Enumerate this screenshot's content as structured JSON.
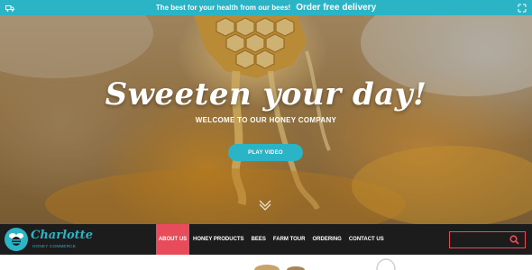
{
  "colors": {
    "accent": "#2bb3c6",
    "nav_active": "#e84b5a",
    "nav_bg": "#1c1c1c"
  },
  "promo": {
    "text": "The best for your health from our bees!",
    "cta": "Order free delivery",
    "left_icon": "truck-icon",
    "right_icon": "expand-icon"
  },
  "hero": {
    "title": "Sweeten your day!",
    "subtitle": "WELCOME TO OUR HONEY COMPANY",
    "button_label": "PLAY VIDEO",
    "scroll_icon": "chevron-down-icon"
  },
  "logo": {
    "name": "Charlotte",
    "tagline": "HONEY COMMERCE",
    "icon": "bee-icon"
  },
  "nav": {
    "items": [
      {
        "label": "ABOUT US",
        "active": true
      },
      {
        "label": "HONEY PRODUCTS"
      },
      {
        "label": "BEES"
      },
      {
        "label": "FARM TOUR"
      },
      {
        "label": "ORDERING"
      },
      {
        "label": "CONTACT US"
      }
    ]
  },
  "search": {
    "value": "",
    "placeholder": "",
    "icon": "search-icon"
  }
}
